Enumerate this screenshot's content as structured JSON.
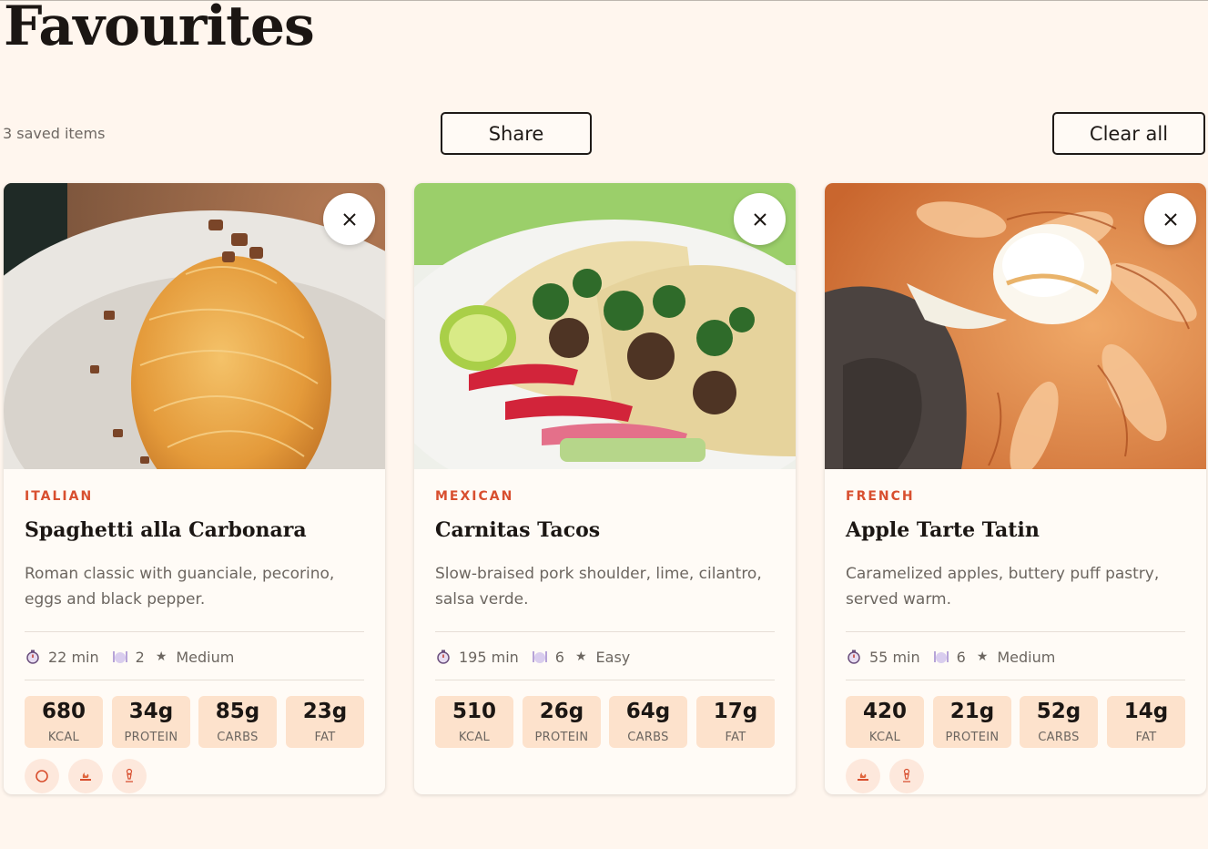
{
  "page": {
    "title": "Favourites",
    "saved_count": "3 saved items",
    "share_label": "Share",
    "clear_label": "Clear all"
  },
  "colors": {
    "background": "#fff6ee",
    "accent": "#d84f2f",
    "nutrition_tile": "#fde2cc",
    "badge": "#fde8dc"
  },
  "cards": [
    {
      "cuisine": "ITALIAN",
      "title": "Spaghetti alla Carbonara",
      "description": "Roman classic with guanciale, pecorino, eggs and black pepper.",
      "image_subject": "spaghetti-carbonara-photo",
      "time": "22 min",
      "servings": "2",
      "difficulty": "Medium",
      "nutrition": [
        {
          "value": "680",
          "label": "KCAL"
        },
        {
          "value": "34g",
          "label": "PROTEIN"
        },
        {
          "value": "85g",
          "label": "CARBS"
        },
        {
          "value": "23g",
          "label": "FAT"
        }
      ],
      "badges": [
        "ring-icon",
        "fire-icon",
        "chef-icon"
      ]
    },
    {
      "cuisine": "MEXICAN",
      "title": "Carnitas Tacos",
      "description": "Slow-braised pork shoulder, lime, cilantro, salsa verde.",
      "image_subject": "carnitas-tacos-photo",
      "time": "195 min",
      "servings": "6",
      "difficulty": "Easy",
      "nutrition": [
        {
          "value": "510",
          "label": "KCAL"
        },
        {
          "value": "26g",
          "label": "PROTEIN"
        },
        {
          "value": "64g",
          "label": "CARBS"
        },
        {
          "value": "17g",
          "label": "FAT"
        }
      ],
      "badges": []
    },
    {
      "cuisine": "FRENCH",
      "title": "Apple Tarte Tatin",
      "description": "Caramelized apples, buttery puff pastry, served warm.",
      "image_subject": "apple-tarte-tatin-photo",
      "time": "55 min",
      "servings": "6",
      "difficulty": "Medium",
      "nutrition": [
        {
          "value": "420",
          "label": "KCAL"
        },
        {
          "value": "21g",
          "label": "PROTEIN"
        },
        {
          "value": "52g",
          "label": "CARBS"
        },
        {
          "value": "14g",
          "label": "FAT"
        }
      ],
      "badges": [
        "fire-icon",
        "chef-icon"
      ]
    }
  ],
  "icons": {
    "close": "close-icon",
    "timer": "stopwatch-icon",
    "servings": "plate-icon",
    "difficulty": "star-icon"
  }
}
